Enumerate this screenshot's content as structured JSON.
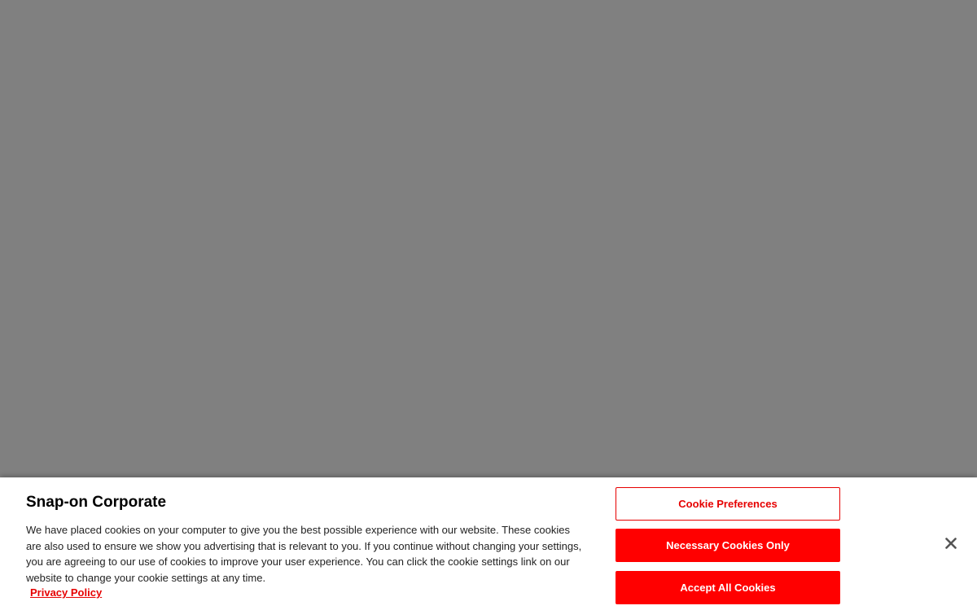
{
  "banner": {
    "title": "Snap-on Corporate",
    "body": "We have placed cookies on your computer to give you the best possible experience with our website. These cookies are also used to ensure we show you advertising that is relevant to you. If you continue without changing your settings, you are agreeing to our use of cookies to improve your user experience. You can click the cookie settings link on our website to change your cookie settings at any time.",
    "privacy_link": "Privacy Policy",
    "buttons": {
      "preferences": "Cookie Preferences",
      "necessary": "Necessary Cookies Only",
      "accept_all": "Accept All Cookies"
    },
    "close_icon": "close-icon"
  },
  "colors": {
    "accent": "#ff0000",
    "overlay": "#808080"
  }
}
